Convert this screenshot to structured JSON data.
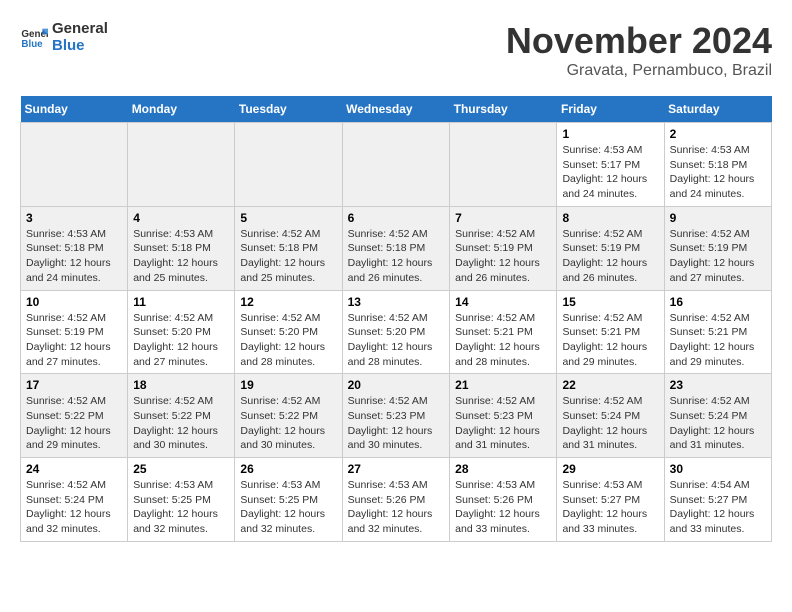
{
  "logo": {
    "line1": "General",
    "line2": "Blue"
  },
  "title": "November 2024",
  "location": "Gravata, Pernambuco, Brazil",
  "days_of_week": [
    "Sunday",
    "Monday",
    "Tuesday",
    "Wednesday",
    "Thursday",
    "Friday",
    "Saturday"
  ],
  "weeks": [
    [
      {
        "day": "",
        "info": ""
      },
      {
        "day": "",
        "info": ""
      },
      {
        "day": "",
        "info": ""
      },
      {
        "day": "",
        "info": ""
      },
      {
        "day": "",
        "info": ""
      },
      {
        "day": "1",
        "info": "Sunrise: 4:53 AM\nSunset: 5:17 PM\nDaylight: 12 hours and 24 minutes."
      },
      {
        "day": "2",
        "info": "Sunrise: 4:53 AM\nSunset: 5:18 PM\nDaylight: 12 hours and 24 minutes."
      }
    ],
    [
      {
        "day": "3",
        "info": "Sunrise: 4:53 AM\nSunset: 5:18 PM\nDaylight: 12 hours and 24 minutes."
      },
      {
        "day": "4",
        "info": "Sunrise: 4:53 AM\nSunset: 5:18 PM\nDaylight: 12 hours and 25 minutes."
      },
      {
        "day": "5",
        "info": "Sunrise: 4:52 AM\nSunset: 5:18 PM\nDaylight: 12 hours and 25 minutes."
      },
      {
        "day": "6",
        "info": "Sunrise: 4:52 AM\nSunset: 5:18 PM\nDaylight: 12 hours and 26 minutes."
      },
      {
        "day": "7",
        "info": "Sunrise: 4:52 AM\nSunset: 5:19 PM\nDaylight: 12 hours and 26 minutes."
      },
      {
        "day": "8",
        "info": "Sunrise: 4:52 AM\nSunset: 5:19 PM\nDaylight: 12 hours and 26 minutes."
      },
      {
        "day": "9",
        "info": "Sunrise: 4:52 AM\nSunset: 5:19 PM\nDaylight: 12 hours and 27 minutes."
      }
    ],
    [
      {
        "day": "10",
        "info": "Sunrise: 4:52 AM\nSunset: 5:19 PM\nDaylight: 12 hours and 27 minutes."
      },
      {
        "day": "11",
        "info": "Sunrise: 4:52 AM\nSunset: 5:20 PM\nDaylight: 12 hours and 27 minutes."
      },
      {
        "day": "12",
        "info": "Sunrise: 4:52 AM\nSunset: 5:20 PM\nDaylight: 12 hours and 28 minutes."
      },
      {
        "day": "13",
        "info": "Sunrise: 4:52 AM\nSunset: 5:20 PM\nDaylight: 12 hours and 28 minutes."
      },
      {
        "day": "14",
        "info": "Sunrise: 4:52 AM\nSunset: 5:21 PM\nDaylight: 12 hours and 28 minutes."
      },
      {
        "day": "15",
        "info": "Sunrise: 4:52 AM\nSunset: 5:21 PM\nDaylight: 12 hours and 29 minutes."
      },
      {
        "day": "16",
        "info": "Sunrise: 4:52 AM\nSunset: 5:21 PM\nDaylight: 12 hours and 29 minutes."
      }
    ],
    [
      {
        "day": "17",
        "info": "Sunrise: 4:52 AM\nSunset: 5:22 PM\nDaylight: 12 hours and 29 minutes."
      },
      {
        "day": "18",
        "info": "Sunrise: 4:52 AM\nSunset: 5:22 PM\nDaylight: 12 hours and 30 minutes."
      },
      {
        "day": "19",
        "info": "Sunrise: 4:52 AM\nSunset: 5:22 PM\nDaylight: 12 hours and 30 minutes."
      },
      {
        "day": "20",
        "info": "Sunrise: 4:52 AM\nSunset: 5:23 PM\nDaylight: 12 hours and 30 minutes."
      },
      {
        "day": "21",
        "info": "Sunrise: 4:52 AM\nSunset: 5:23 PM\nDaylight: 12 hours and 31 minutes."
      },
      {
        "day": "22",
        "info": "Sunrise: 4:52 AM\nSunset: 5:24 PM\nDaylight: 12 hours and 31 minutes."
      },
      {
        "day": "23",
        "info": "Sunrise: 4:52 AM\nSunset: 5:24 PM\nDaylight: 12 hours and 31 minutes."
      }
    ],
    [
      {
        "day": "24",
        "info": "Sunrise: 4:52 AM\nSunset: 5:24 PM\nDaylight: 12 hours and 32 minutes."
      },
      {
        "day": "25",
        "info": "Sunrise: 4:53 AM\nSunset: 5:25 PM\nDaylight: 12 hours and 32 minutes."
      },
      {
        "day": "26",
        "info": "Sunrise: 4:53 AM\nSunset: 5:25 PM\nDaylight: 12 hours and 32 minutes."
      },
      {
        "day": "27",
        "info": "Sunrise: 4:53 AM\nSunset: 5:26 PM\nDaylight: 12 hours and 32 minutes."
      },
      {
        "day": "28",
        "info": "Sunrise: 4:53 AM\nSunset: 5:26 PM\nDaylight: 12 hours and 33 minutes."
      },
      {
        "day": "29",
        "info": "Sunrise: 4:53 AM\nSunset: 5:27 PM\nDaylight: 12 hours and 33 minutes."
      },
      {
        "day": "30",
        "info": "Sunrise: 4:54 AM\nSunset: 5:27 PM\nDaylight: 12 hours and 33 minutes."
      }
    ]
  ]
}
